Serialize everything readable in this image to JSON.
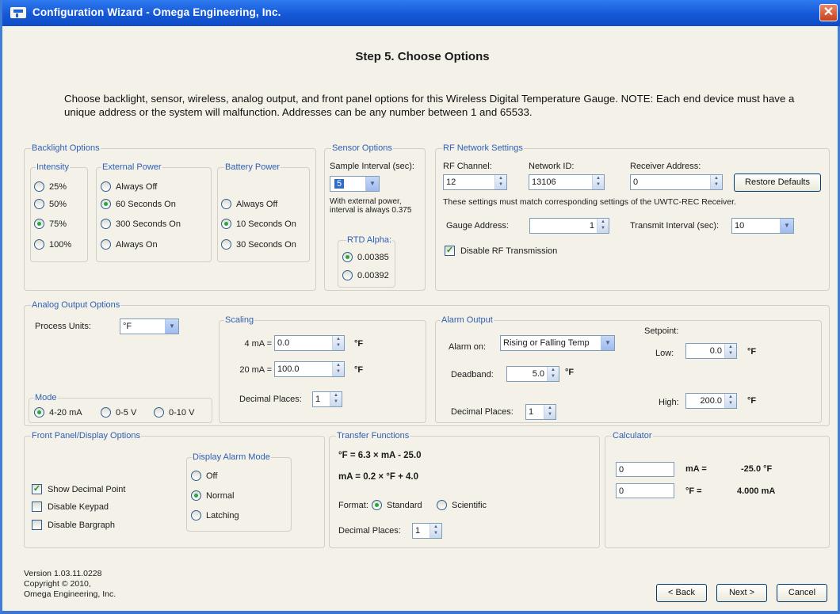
{
  "window": {
    "title": "Configuration Wizard - Omega Engineering, Inc."
  },
  "heading": "Step 5.  Choose Options",
  "instructions": "Choose backlight, sensor, wireless, analog output, and front panel options for this Wireless Digital Temperature Gauge.  NOTE: Each end device must have a unique address or the system will malfunction.  Addresses can be any number between 1 and 65533.",
  "backlight": {
    "title": "Backlight Options",
    "intensity": {
      "title": "Intensity",
      "options": [
        "25%",
        "50%",
        "75%",
        "100%"
      ],
      "selected": "75%"
    },
    "external_power": {
      "title": "External Power",
      "options": [
        "Always Off",
        "60 Seconds On",
        "300 Seconds On",
        "Always On"
      ],
      "selected": "60 Seconds On"
    },
    "battery_power": {
      "title": "Battery Power",
      "options": [
        "Always Off",
        "10 Seconds On",
        "30 Seconds On"
      ],
      "selected": "10 Seconds On"
    }
  },
  "sensor": {
    "title": "Sensor Options",
    "interval_label": "Sample Interval (sec):",
    "interval_value": "5",
    "note": "With external power, interval is always 0.375",
    "rtd": {
      "title": "RTD Alpha:",
      "options": [
        "0.00385",
        "0.00392"
      ],
      "selected": "0.00385"
    }
  },
  "rf": {
    "title": "RF Network Settings",
    "channel_label": "RF Channel:",
    "channel_value": "12",
    "network_label": "Network ID:",
    "network_value": "13106",
    "receiver_label": "Receiver Address:",
    "receiver_value": "0",
    "restore_label": "Restore Defaults",
    "note": "These settings must match corresponding settings of the UWTC-REC Receiver.",
    "gauge_label": "Gauge Address:",
    "gauge_value": "1",
    "transmit_label": "Transmit Interval (sec):",
    "transmit_value": "10",
    "disable_label": "Disable RF Transmission",
    "disable_checked": true
  },
  "analog": {
    "title": "Analog Output Options",
    "units_label": "Process Units:",
    "units_value": "°F",
    "mode": {
      "title": "Mode",
      "options": [
        "4-20 mA",
        "0-5 V",
        "0-10 V"
      ],
      "selected": "4-20 mA"
    },
    "scaling": {
      "title": "Scaling",
      "ma4_label": "4 mA =",
      "ma4_value": "0.0",
      "ma20_label": "20 mA =",
      "ma20_value": "100.0",
      "unit": "°F",
      "decimals_label": "Decimal Places:",
      "decimals_value": "1"
    },
    "alarm": {
      "title": "Alarm Output",
      "alarm_on_label": "Alarm on:",
      "alarm_on_value": "Rising or Falling Temp",
      "deadband_label": "Deadband:",
      "deadband_value": "5.0",
      "decimals_label": "Decimal Places:",
      "decimals_value": "1",
      "setpoint_label": "Setpoint:",
      "low_label": "Low:",
      "low_value": "0.0",
      "high_label": "High:",
      "high_value": "200.0",
      "unit": "°F"
    }
  },
  "front_panel": {
    "title": "Front Panel/Display Options",
    "checkboxes": [
      {
        "label": "Show Decimal Point",
        "checked": true
      },
      {
        "label": "Disable Keypad",
        "checked": false
      },
      {
        "label": "Disable Bargraph",
        "checked": false
      }
    ],
    "alarm_mode": {
      "title": "Display Alarm Mode",
      "options": [
        "Off",
        "Normal",
        "Latching"
      ],
      "selected": "Normal"
    }
  },
  "transfer": {
    "title": "Transfer Functions",
    "formula1": "°F = 6.3 × mA - 25.0",
    "formula2": "mA = 0.2 × °F + 4.0",
    "format_label": "Format:",
    "format_options": [
      "Standard",
      "Scientific"
    ],
    "format_selected": "Standard",
    "decimals_label": "Decimal Places:",
    "decimals_value": "1"
  },
  "calculator": {
    "title": "Calculator",
    "input1": "0",
    "label1": "mA =",
    "result1": "-25.0 °F",
    "input2": "0",
    "label2": "°F =",
    "result2": "4.000 mA"
  },
  "footer": {
    "version": "Version 1.03.11.0228",
    "copyright": "Copyright © 2010,",
    "company": "Omega Engineering, Inc.",
    "back": "< Back",
    "next": "Next >",
    "cancel": "Cancel"
  }
}
